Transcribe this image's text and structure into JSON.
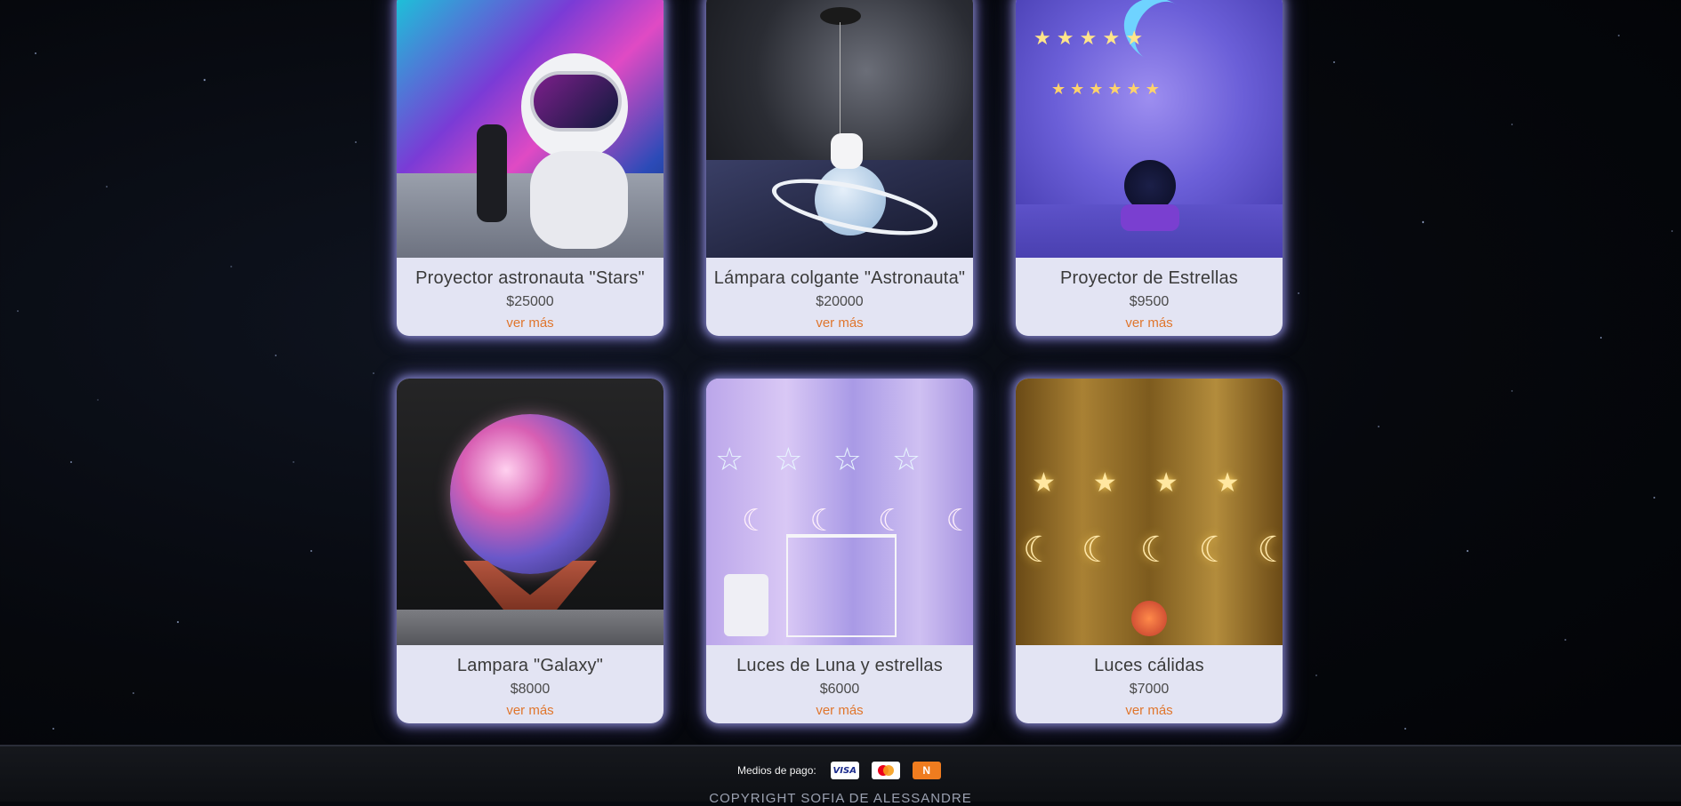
{
  "products": [
    {
      "title": "Proyector astronauta \"Stars\"",
      "price": "$25000",
      "more": "ver más"
    },
    {
      "title": "Lámpara colgante \"Astronauta\"",
      "price": "$20000",
      "more": "ver más"
    },
    {
      "title": "Proyector de Estrellas",
      "price": "$9500",
      "more": "ver más"
    },
    {
      "title": "Lampara \"Galaxy\"",
      "price": "$8000",
      "more": "ver más"
    },
    {
      "title": "Luces de Luna y estrellas",
      "price": "$6000",
      "more": "ver más"
    },
    {
      "title": "Luces cálidas",
      "price": "$7000",
      "more": "ver más"
    }
  ],
  "footer": {
    "payment_label": "Medios de pago:",
    "payment_methods": [
      {
        "icon": "visa-icon",
        "label": "VISA"
      },
      {
        "icon": "mastercard-icon"
      },
      {
        "icon": "naranja-icon"
      }
    ],
    "copyright": "COPYRIGHT SOFIA DE ALESSANDRE"
  },
  "colors": {
    "card_bg": "#e3e4f3",
    "link": "#e0762d",
    "page_bg": "#06080d"
  }
}
